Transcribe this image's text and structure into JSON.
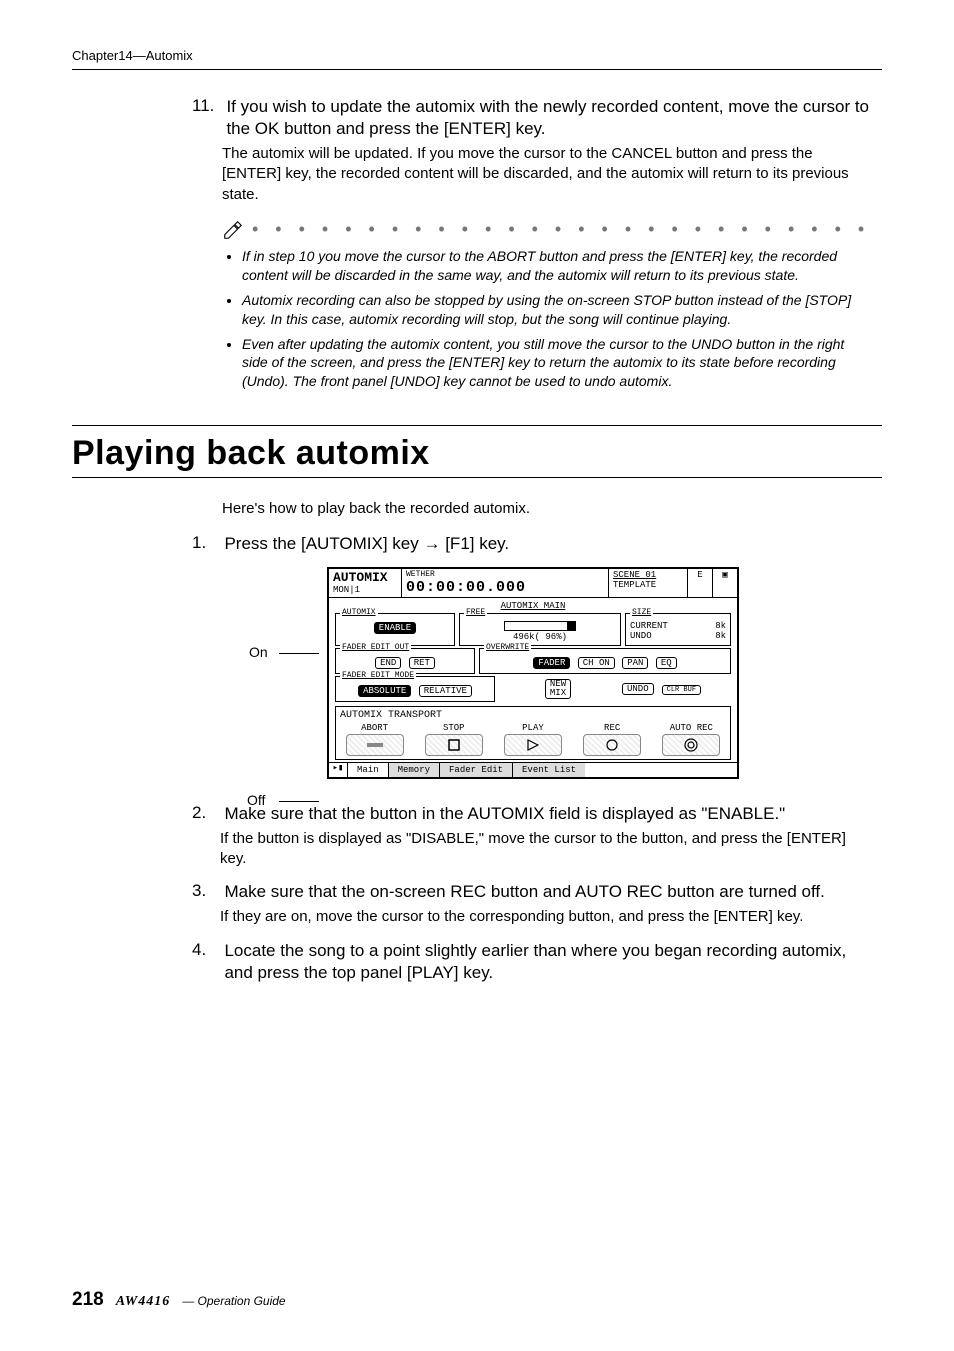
{
  "chapter_header": "Chapter14—Automix",
  "step11": {
    "num": "11.",
    "title": "If you wish to update the automix with the newly recorded content, move the cursor to the OK button and press the [ENTER] key.",
    "body": "The automix will be updated. If you move the cursor to the CANCEL button and press the [ENTER] key, the recorded content will be discarded, and the automix will return to its previous state."
  },
  "notes": [
    "If in step 10 you move the cursor to the ABORT button and press the [ENTER] key, the recorded content will be discarded in the same way, and the automix will return to its previous state.",
    "Automix recording can also be stopped by using the on-screen STOP button instead of the [STOP] key. In this case, automix recording will stop, but the song will continue playing.",
    "Even after updating the automix content, you still move the cursor to the UNDO button in the right side of the screen, and press the [ENTER] key to return the automix to its state before recording (Undo). The front panel [UNDO] key cannot be used to undo automix."
  ],
  "section_title": "Playing back automix",
  "intro": "Here's how to play back the recorded automix.",
  "step1": {
    "num": "1.",
    "title_pre": "Press the [AUTOMIX] key ",
    "title_post": " [F1] key."
  },
  "labels": {
    "on": "On",
    "off": "Off"
  },
  "lcd": {
    "title_top": "AUTOMIX",
    "title_bot": "MON|1",
    "wether": "WETHER",
    "timecode": "00:00:00.000",
    "scene_lbl": "SCENE 01",
    "scene_sub": "TEMPLATE",
    "flag": "E",
    "main_sec": "AUTOMIX MAIN",
    "automix_grp": "AUTOMIX",
    "enable_btn": "ENABLE",
    "free_grp": "FREE",
    "free_val": "496k( 96%)",
    "size_grp": "SIZE",
    "current_lbl": "CURRENT",
    "current_val": "8k",
    "undo_lbl": "UNDO",
    "undo_val": "8k",
    "fadeout_grp": "FADER EDIT OUT",
    "end_btn": "END",
    "ret_btn": "RET",
    "overwrite_grp": "OVERWRITE",
    "fader_btn": "FADER",
    "chon_btn": "CH ON",
    "pan_btn": "PAN",
    "eq_btn": "EQ",
    "fadeemode_grp": "FADER EDIT MODE",
    "abs_btn": "ABSOLUTE",
    "rel_btn": "RELATIVE",
    "newmix_btn": "NEW\nMIX",
    "undo_btn": "UNDO",
    "clrbuf_btn": "CLR BUF",
    "transport_grp": "AUTOMIX TRANSPORT",
    "abort": "ABORT",
    "stop": "STOP",
    "play": "PLAY",
    "rec": "REC",
    "autorec": "AUTO REC",
    "tabs": [
      "Main",
      "Memory",
      "Fader Edit",
      "Event List"
    ]
  },
  "step2": {
    "num": "2.",
    "title": "Make sure that the button in the AUTOMIX field is displayed as \"ENABLE.\"",
    "body": "If the button is displayed as \"DISABLE,\" move the cursor to the button, and press the [ENTER] key."
  },
  "step3": {
    "num": "3.",
    "title": "Make sure that the on-screen REC button and AUTO REC button are turned off.",
    "body": "If they are on, move the cursor to the corresponding button, and press the [ENTER] key."
  },
  "step4": {
    "num": "4.",
    "title": "Locate the song to a point slightly earlier than where you began recording automix, and press the top panel [PLAY] key."
  },
  "footer": {
    "page": "218",
    "model": "AW4416",
    "guide": "— Operation Guide"
  }
}
